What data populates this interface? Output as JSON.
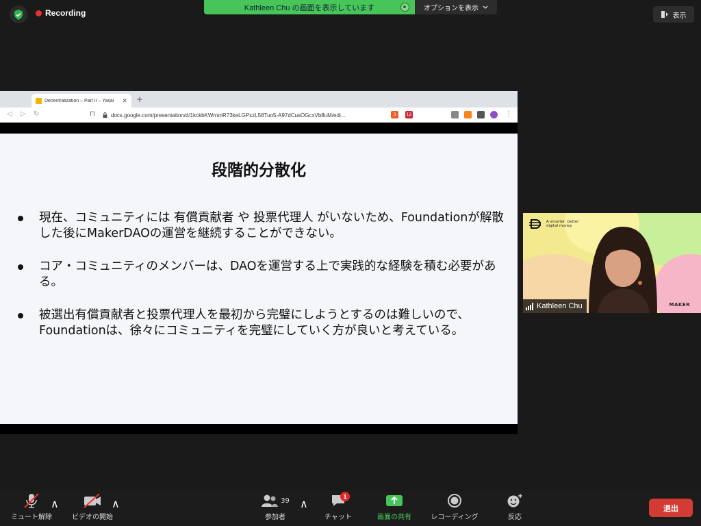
{
  "top_bar": {
    "recording_label": "Recording",
    "share_banner_text": "Kathleen Chu の画面を表示しています",
    "options_label": "オプションを表示",
    "view_label": "表示"
  },
  "browser": {
    "tab_title": "Decentralization – Part II – Yasai",
    "url": "docs.google.com/presentation/d/1kckbKWrnmR73keLGPxzL58Tuo5-A97dCusOGcxVb8uM/edi...",
    "shield_badge": "3",
    "alert_badge": "12"
  },
  "slide": {
    "title": "段階的分散化",
    "bullets": [
      "現在、コミュニティには 有償貢献者 や 投票代理人 がいないため、Foundationが解散した後にMakerDAOの運営を継続することができない。",
      "コア・コミュニティのメンバーは、DAOを運営する上で実践的な経験を積む必要がある。",
      "被選出有償貢献者と投票代理人を最初から完璧にしようとするのは難しいので、Foundationは、徐々にコミュニティを完璧にしていく方が良いと考えている。"
    ]
  },
  "participant": {
    "name": "Kathleen Chu",
    "brand_tagline_1": "A smarter, better",
    "brand_tagline_2": "digital money",
    "maker_label": "MAKER"
  },
  "toolbar": {
    "mute_label": "ミュート解除",
    "video_label": "ビデオの開始",
    "participants_label": "参加者",
    "participants_count": "39",
    "chat_label": "チャット",
    "chat_badge": "1",
    "share_label": "画面の共有",
    "record_label": "レコーディング",
    "reactions_label": "反応",
    "leave_label": "退出"
  },
  "colors": {
    "share_green": "#47c559",
    "record_red": "#e5342f",
    "leave_red": "#d33c34"
  }
}
